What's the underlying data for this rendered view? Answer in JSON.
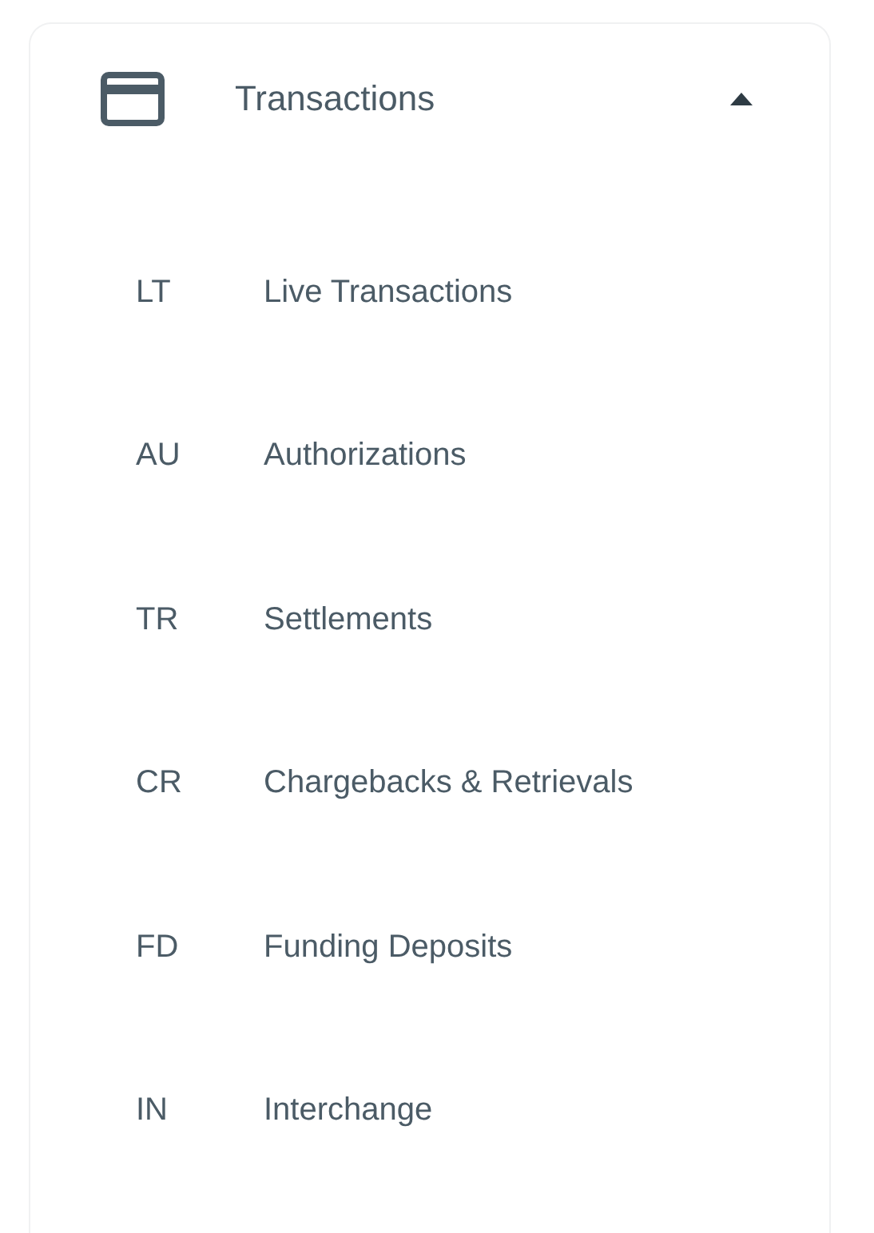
{
  "section": {
    "title": "Transactions",
    "expanded": true
  },
  "items": [
    {
      "abbr": "LT",
      "label": "Live Transactions"
    },
    {
      "abbr": "AU",
      "label": "Authorizations"
    },
    {
      "abbr": "TR",
      "label": "Settlements"
    },
    {
      "abbr": "CR",
      "label": "Chargebacks & Retrievals"
    },
    {
      "abbr": "FD",
      "label": "Funding Deposits"
    },
    {
      "abbr": "IN",
      "label": "Interchange"
    }
  ]
}
